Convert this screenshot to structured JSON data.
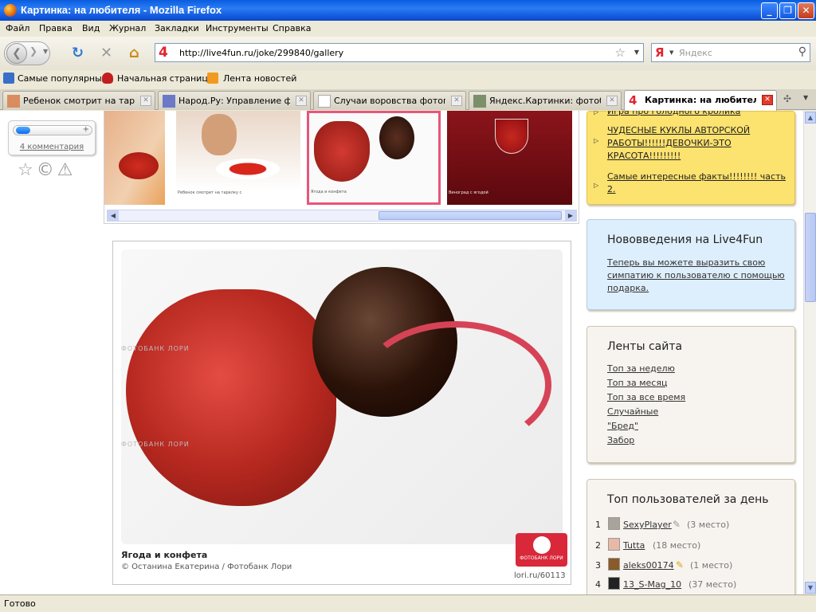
{
  "window": {
    "title": "Картинка: на любителя - Mozilla Firefox"
  },
  "menu": [
    "Файл",
    "Правка",
    "Вид",
    "Журнал",
    "Закладки",
    "Инструменты",
    "Справка"
  ],
  "url": "http://live4fun.ru/joke/299840/gallery",
  "search_placeholder": "Яндекс",
  "search_engine_label": "Я",
  "site_icon": "4",
  "bookmarks": [
    "Самые популярные",
    "Начальная страница",
    "Лента новостей"
  ],
  "tabs": [
    {
      "label": "Ребенок смотрит на таре...",
      "active": false
    },
    {
      "label": "Народ.Ру: Управление фа...",
      "active": false
    },
    {
      "label": "Случаи воровства фотогр...",
      "active": false
    },
    {
      "label": "Яндекс.Картинки: фотоб...",
      "active": false
    },
    {
      "label": "Картинка: на любителя",
      "active": true
    }
  ],
  "vote": {
    "comments": "4 комментария",
    "plus": "+"
  },
  "gallery_thumbs": [
    {
      "caption": "",
      "color": "#e9b98a"
    },
    {
      "caption": "Ребенок смотрит на тарелку с",
      "color": "#d8b59a"
    },
    {
      "caption": "Ягода и конфета",
      "color": "#f4f4f4"
    },
    {
      "caption": "Виноград с ягодой",
      "color": "#7a0f16"
    }
  ],
  "main_image": {
    "caption": "Ягода и конфета",
    "credit": "© Останина Екатерина / Фотобанк Лори",
    "watermark": "ФОТОБАНК ЛОРИ",
    "logo_text": "ФОТОБАНК ЛОРИ",
    "link": "lori.ru/60113"
  },
  "yellow_panel": {
    "items": [
      "Игра про голодного кролика",
      "ЧУДЕСНЫЕ КУКЛЫ АВТОРСКОЙ РАБОТЫ!!!!!!ДЕВОЧКИ-ЭТО КРАСОТА!!!!!!!!!",
      "Самые интересные факты!!!!!!!! часть 2."
    ]
  },
  "news_panel": {
    "title": "Нововведения на Live4Fun",
    "text": "Теперь вы можете выразить свою симпатию к пользователю с помощью подарка."
  },
  "feeds_panel": {
    "title": "Ленты сайта",
    "links": [
      "Топ за неделю",
      "Топ за месяц",
      "Топ за все время",
      "Случайные",
      "\"Бред\"",
      "Забор"
    ]
  },
  "top_users": {
    "title": "Топ пользователей за день",
    "users": [
      {
        "n": "1",
        "name": "SexyPlayer",
        "place": "(3 место)"
      },
      {
        "n": "2",
        "name": "Tutta",
        "place": "(18 место)"
      },
      {
        "n": "3",
        "name": "aleks00174",
        "place": "(1 место)"
      },
      {
        "n": "4",
        "name": "13_S-Mag_10",
        "place": "(37 место)"
      }
    ]
  },
  "status": "Готово"
}
